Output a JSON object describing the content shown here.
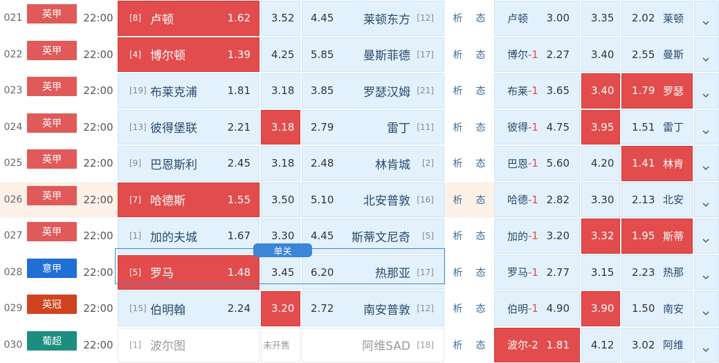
{
  "colors": {
    "epl": "#e05a5a",
    "seriea": "#1f6fd6",
    "champ": "#d0431f",
    "portugal": "#1d8d80",
    "hot": "#e24c4c",
    "cell": "#e3f1fc"
  },
  "single_label": "单关",
  "analysis_labels": [
    "析",
    "态"
  ],
  "rows": [
    {
      "num": "021",
      "league": "英甲",
      "lc": "epl",
      "time": "22:00",
      "hr": "[8]",
      "home": "卢顿",
      "hodd": "1.62",
      "hred": true,
      "draw": "3.52",
      "dred": false,
      "away": "莱顿东方",
      "ar": "[12]",
      "aodd": "4.45",
      "ared": false,
      "rqname": "卢顿",
      "rq": "",
      "rqw": "3.00",
      "rqwred": false,
      "rqd": "3.35",
      "rqdred": false,
      "rql": "2.02",
      "rqlred": false,
      "rqaway": "莱顿"
    },
    {
      "num": "022",
      "league": "英甲",
      "lc": "epl",
      "time": "22:00",
      "hr": "[4]",
      "home": "博尔顿",
      "hodd": "1.39",
      "hred": true,
      "draw": "4.25",
      "dred": false,
      "away": "曼斯菲德",
      "ar": "[17]",
      "aodd": "5.85",
      "ared": false,
      "rqname": "博尔",
      "rq": "-1",
      "rqw": "2.27",
      "rqwred": false,
      "rqd": "3.40",
      "rqdred": false,
      "rql": "2.55",
      "rqlred": false,
      "rqaway": "曼斯"
    },
    {
      "num": "023",
      "league": "英甲",
      "lc": "epl",
      "time": "22:00",
      "hr": "[19]",
      "home": "布莱克浦",
      "hodd": "1.81",
      "hred": false,
      "draw": "3.18",
      "dred": false,
      "away": "罗瑟汉姆",
      "ar": "[21]",
      "aodd": "3.85",
      "ared": false,
      "rqname": "布莱",
      "rq": "-1",
      "rqw": "3.65",
      "rqwred": false,
      "rqd": "3.40",
      "rqdred": true,
      "rql": "1.79",
      "rqlred": true,
      "rqaway": "罗瑟"
    },
    {
      "num": "024",
      "league": "英甲",
      "lc": "epl",
      "time": "22:00",
      "hr": "[13]",
      "home": "彼得堡联",
      "hodd": "2.21",
      "hred": false,
      "draw": "3.18",
      "dred": true,
      "away": "雷丁",
      "ar": "[11]",
      "aodd": "2.79",
      "ared": false,
      "rqname": "彼得",
      "rq": "-1",
      "rqw": "4.75",
      "rqwred": false,
      "rqd": "3.95",
      "rqdred": true,
      "rql": "1.51",
      "rqlred": false,
      "rqaway": "雷丁"
    },
    {
      "num": "025",
      "league": "英甲",
      "lc": "epl",
      "time": "22:00",
      "hr": "[9]",
      "home": "巴恩斯利",
      "hodd": "2.45",
      "hred": false,
      "draw": "3.18",
      "dred": false,
      "away": "林肯城",
      "ar": "[2]",
      "aodd": "2.48",
      "ared": false,
      "rqname": "巴恩",
      "rq": "-1",
      "rqw": "5.60",
      "rqwred": false,
      "rqd": "4.20",
      "rqdred": false,
      "rql": "1.41",
      "rqlred": true,
      "rqaway": "林肯"
    },
    {
      "num": "026",
      "league": "英甲",
      "lc": "epl",
      "time": "22:00",
      "hr": "[7]",
      "home": "哈德斯",
      "hodd": "1.55",
      "hred": true,
      "draw": "3.50",
      "dred": false,
      "away": "北安普敦",
      "ar": "[16]",
      "aodd": "5.10",
      "ared": false,
      "rqname": "哈德",
      "rq": "-1",
      "rqw": "2.82",
      "rqwred": false,
      "rqd": "3.30",
      "rqdred": false,
      "rql": "2.13",
      "rqlred": false,
      "rqaway": "北安",
      "hl": true
    },
    {
      "num": "027",
      "league": "英甲",
      "lc": "epl",
      "time": "22:00",
      "hr": "[1]",
      "home": "加的夫城",
      "hodd": "1.67",
      "hred": false,
      "draw": "3.30",
      "dred": false,
      "away": "斯蒂文尼奇",
      "ar": "[5]",
      "aodd": "4.45",
      "ared": false,
      "rqname": "加的",
      "rq": "-1",
      "rqw": "3.20",
      "rqwred": false,
      "rqd": "3.32",
      "rqdred": true,
      "rql": "1.95",
      "rqlred": true,
      "rqaway": "斯蒂"
    },
    {
      "num": "028",
      "league": "意甲",
      "lc": "seriea",
      "time": "22:00",
      "hr": "[5]",
      "home": "罗马",
      "hodd": "1.48",
      "hred": true,
      "draw": "3.45",
      "dred": false,
      "away": "热那亚",
      "ar": "[17]",
      "aodd": "6.20",
      "ared": false,
      "rqname": "罗马",
      "rq": "-1",
      "rqw": "2.77",
      "rqwred": false,
      "rqd": "3.15",
      "rqdred": false,
      "rql": "2.23",
      "rqlred": false,
      "rqaway": "热那",
      "sel": true
    },
    {
      "num": "029",
      "league": "英冠",
      "lc": "champ",
      "time": "22:00",
      "hr": "[15]",
      "home": "伯明翰",
      "hodd": "2.24",
      "hred": false,
      "draw": "3.20",
      "dred": true,
      "away": "南安普敦",
      "ar": "[12]",
      "aodd": "2.72",
      "ared": false,
      "rqname": "伯明",
      "rq": "-1",
      "rqw": "4.90",
      "rqwred": false,
      "rqd": "3.90",
      "rqdred": true,
      "rql": "1.50",
      "rqlred": false,
      "rqaway": "南安"
    },
    {
      "num": "030",
      "league": "葡超",
      "lc": "portugal",
      "time": "22:00",
      "hr": "[1]",
      "home": "波尔图",
      "hodd": "",
      "hred": false,
      "draw": "未开售",
      "dred": false,
      "away": "阿维SAD",
      "ar": "[18]",
      "aodd": "",
      "ared": false,
      "rqname": "波尔",
      "rq": "-2",
      "rqw": "1.81",
      "rqwred": true,
      "rqd": "4.12",
      "rqdred": false,
      "rql": "3.02",
      "rqlred": false,
      "rqaway": "阿维",
      "closed": true
    }
  ]
}
